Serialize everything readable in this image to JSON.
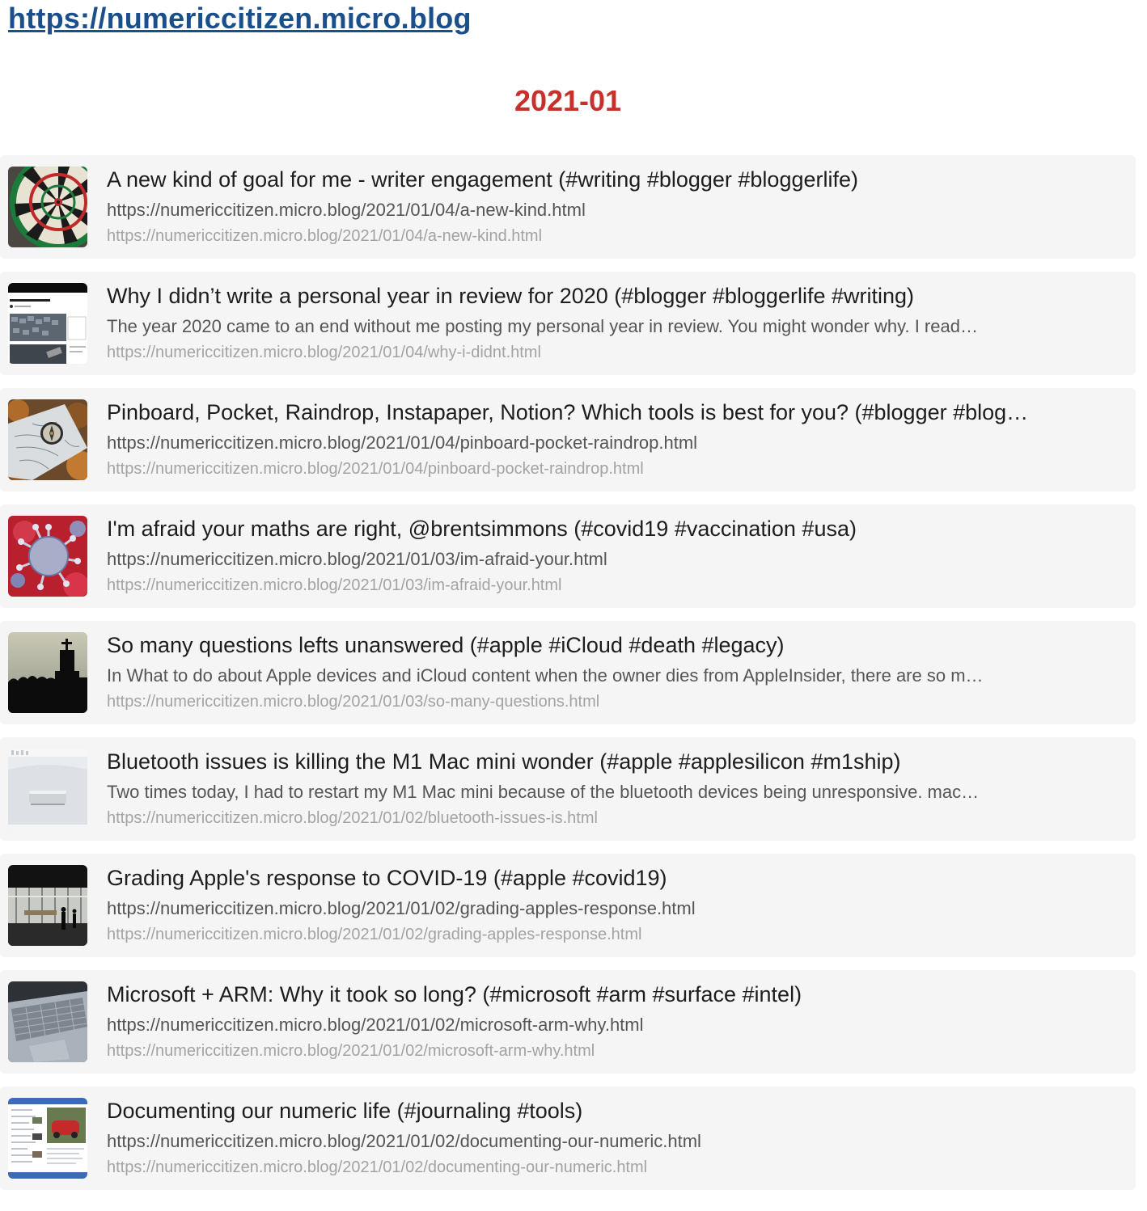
{
  "site": {
    "url_label": "https://numericcitizen.micro.blog"
  },
  "month": "2021-01",
  "posts": [
    {
      "title": "A new kind of goal for me - writer engagement (#writing #blogger #bloggerlife)",
      "description": "https://numericcitizen.micro.blog/2021/01/04/a-new-kind.html",
      "url": "https://numericcitizen.micro.blog/2021/01/04/a-new-kind.html",
      "thumbnail": "dartboard-image"
    },
    {
      "title": "Why I didn’t write a personal year in review for 2020 (#blogger #bloggerlife #writing)",
      "description": "The year 2020 came to an end without me posting my personal year in review. You might wonder why. I read…",
      "url": "https://numericcitizen.micro.blog/2021/01/04/why-i-didnt.html",
      "thumbnail": "blog-post-screenshot-image"
    },
    {
      "title": "Pinboard, Pocket, Raindrop, Instapaper, Notion? Which tools is best for you? (#blogger #blog…",
      "description": "https://numericcitizen.micro.blog/2021/01/04/pinboard-pocket-raindrop.html",
      "url": "https://numericcitizen.micro.blog/2021/01/04/pinboard-pocket-raindrop.html",
      "thumbnail": "compass-map-image"
    },
    {
      "title": "I'm afraid your maths are right, @brentsimmons (#covid19 #vaccination #usa)",
      "description": "https://numericcitizen.micro.blog/2021/01/03/im-afraid-your.html",
      "url": "https://numericcitizen.micro.blog/2021/01/03/im-afraid-your.html",
      "thumbnail": "virus-image"
    },
    {
      "title": "So many questions lefts unanswered (#apple #iCloud #death #legacy)",
      "description": "In What to do about Apple devices and iCloud content when the owner dies from AppleInsider, there are so m…",
      "url": "https://numericcitizen.micro.blog/2021/01/03/so-many-questions.html",
      "thumbnail": "cemetery-silhouette-image"
    },
    {
      "title": "Bluetooth issues is killing the M1 Mac mini wonder (#apple #applesilicon #m1ship)",
      "description": "Two times today, I had to restart my M1 Mac mini because of the bluetooth devices being unresponsive. mac…",
      "url": "https://numericcitizen.micro.blog/2021/01/02/bluetooth-issues-is.html",
      "thumbnail": "mac-mini-image"
    },
    {
      "title": "Grading Apple's response to COVID-19 (#apple #covid19)",
      "description": "https://numericcitizen.micro.blog/2021/01/02/grading-apples-response.html",
      "url": "https://numericcitizen.micro.blog/2021/01/02/grading-apples-response.html",
      "thumbnail": "apple-store-image"
    },
    {
      "title": "Microsoft + ARM: Why it took so long? (#microsoft #arm #surface #intel)",
      "description": "https://numericcitizen.micro.blog/2021/01/02/microsoft-arm-why.html",
      "url": "https://numericcitizen.micro.blog/2021/01/02/microsoft-arm-why.html",
      "thumbnail": "laptop-keyboard-image"
    },
    {
      "title": "Documenting our numeric life (#journaling #tools)",
      "description": "https://numericcitizen.micro.blog/2021/01/02/documenting-our-numeric.html",
      "url": "https://numericcitizen.micro.blog/2021/01/02/documenting-our-numeric.html",
      "thumbnail": "journal-app-screenshot-image"
    }
  ],
  "colors": {
    "link": "#1a4f8b",
    "heading": "#c8312b",
    "card_background": "#f5f5f5",
    "title_text": "#1d1d1f",
    "description_text": "#555555",
    "url_text": "#a3a3a3"
  }
}
